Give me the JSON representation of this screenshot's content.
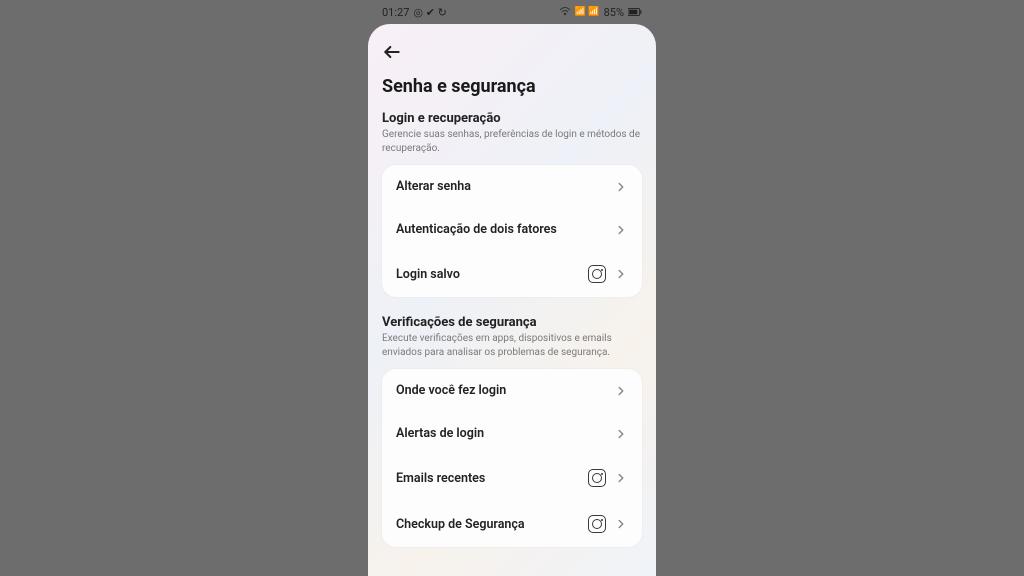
{
  "status": {
    "time": "01:27",
    "icons_left": "◎ ✔ ↻",
    "icons_right": "📶 📶",
    "battery": "85%"
  },
  "header": {
    "title": "Senha e segurança"
  },
  "sections": [
    {
      "title": "Login e recuperação",
      "desc": "Gerencie suas senhas, preferências de login e métodos de recuperação.",
      "items": [
        {
          "label": "Alterar senha",
          "instagram": false
        },
        {
          "label": "Autenticação de dois fatores",
          "instagram": false
        },
        {
          "label": "Login salvo",
          "instagram": true
        }
      ]
    },
    {
      "title": "Verificações de segurança",
      "desc": "Execute verificações em apps, dispositivos e emails enviados para analisar os problemas de segurança.",
      "items": [
        {
          "label": "Onde você fez login",
          "instagram": false
        },
        {
          "label": "Alertas de login",
          "instagram": false
        },
        {
          "label": "Emails recentes",
          "instagram": true
        },
        {
          "label": "Checkup de Segurança",
          "instagram": true
        }
      ]
    }
  ]
}
